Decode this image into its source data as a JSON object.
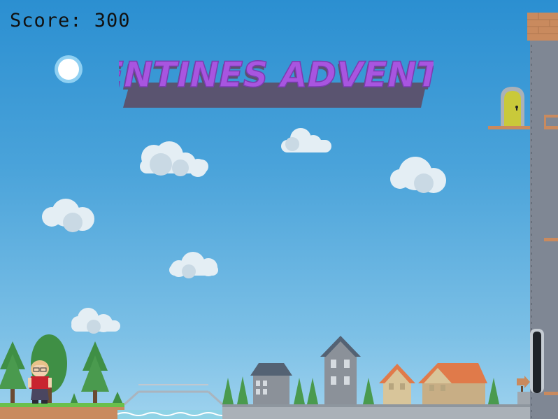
{
  "hud": {
    "score_label": "Score: 300"
  },
  "game": {
    "title": "VALENTINES ADVENTURE"
  },
  "colors": {
    "sky_top": "#2b8fd1",
    "sky_bottom": "#9ed2ee",
    "title_fill": "#a855e0",
    "title_shadow": "#5a5470",
    "door": "#c9c93a",
    "tower": "#7f8794",
    "brick": "#c98a5e"
  },
  "icons": [
    "sun-icon",
    "cloud-icon",
    "door-icon",
    "arrow-sign-icon",
    "player-character"
  ]
}
